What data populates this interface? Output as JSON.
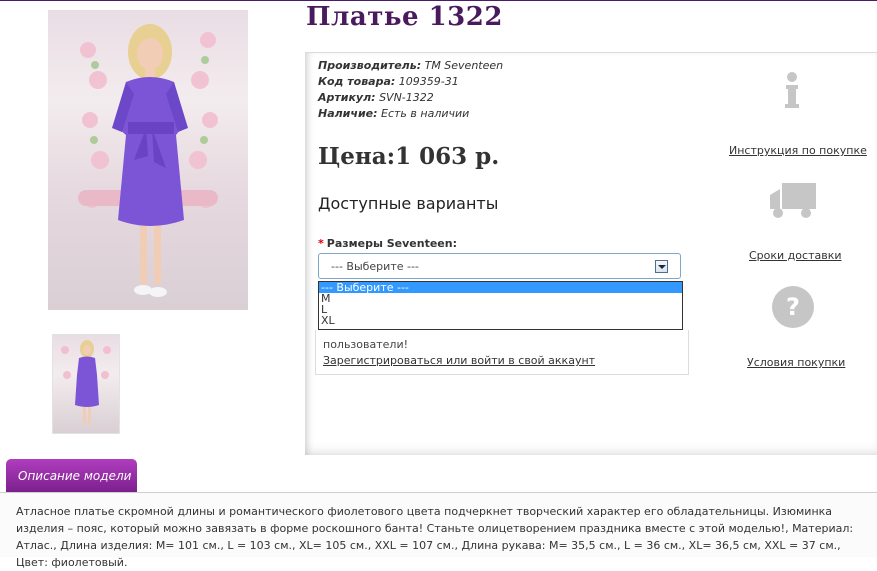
{
  "product": {
    "title": "Платье 1322",
    "specs": [
      {
        "label": "Производитель:",
        "value": "TM Seventeen"
      },
      {
        "label": "Код товара:",
        "value": "109359-31"
      },
      {
        "label": "Артикул:",
        "value": "SVN-1322"
      },
      {
        "label": "Наличие:",
        "value": "Есть в наличии"
      }
    ],
    "price": "Цена:1 063 р.",
    "variants_heading": "Доступные варианты",
    "size_label": "Размеры Seventeen:",
    "required_mark": "*",
    "select_value": "--- Выберите ---",
    "options": [
      "--- Выберите ---",
      "M",
      "L",
      "XL"
    ]
  },
  "login_notice": {
    "line1": "пользователи!",
    "link": "Зарегистрироваться или войти в свой аккаунт"
  },
  "side_links": {
    "instructions": "Инструкция по покупке",
    "delivery": "Сроки доставки",
    "terms": "Условия покупки"
  },
  "description": {
    "tab_label": "Описание модели",
    "text": "Атласное платье скромной длины и романтического фиолетового цвета подчеркнет творческий характер его обладательницы. Изюминка изделия – пояс, который можно завязать в форме роскошного банта! Станьте олицетворением праздника вместе с этой моделью!, Материал: Атлас., Длина изделия: M= 101 см., L = 103 см., XL= 105 см., XXL = 107 см., Длина рукава: M= 35,5 см., L = 36 см., XL= 36,5 см, XXL = 37 см., Цвет: фиолетовый."
  },
  "colors": {
    "accent": "#7a1f8c",
    "title": "#4a1a5f",
    "dress": "#7b55d6"
  }
}
